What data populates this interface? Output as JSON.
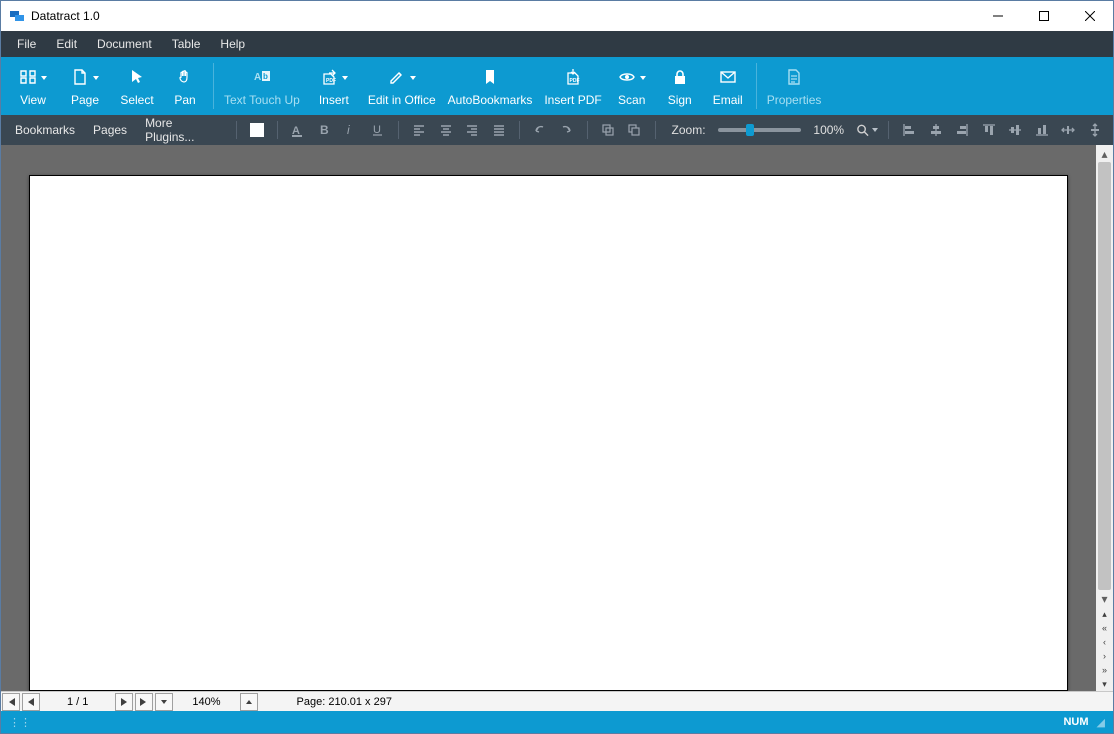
{
  "window": {
    "title": "Datatract 1.0"
  },
  "menubar": {
    "items": [
      "File",
      "Edit",
      "Document",
      "Table",
      "Help"
    ]
  },
  "ribbon": {
    "view": "View",
    "page": "Page",
    "select": "Select",
    "pan": "Pan",
    "text_touch_up": "Text Touch Up",
    "insert": "Insert",
    "edit_in_office": "Edit in Office",
    "auto_bookmarks": "AutoBookmarks",
    "insert_pdf": "Insert PDF",
    "scan": "Scan",
    "sign": "Sign",
    "email": "Email",
    "properties": "Properties"
  },
  "toolbar2": {
    "bookmarks": "Bookmarks",
    "pages": "Pages",
    "more_plugins": "More Plugins...",
    "zoom_label": "Zoom:",
    "zoom_value": "100%"
  },
  "navbar": {
    "page_count": "1 / 1",
    "zoom": "140%",
    "page_size": "Page: 210.01 x 297"
  },
  "statusbar": {
    "num": "NUM"
  }
}
